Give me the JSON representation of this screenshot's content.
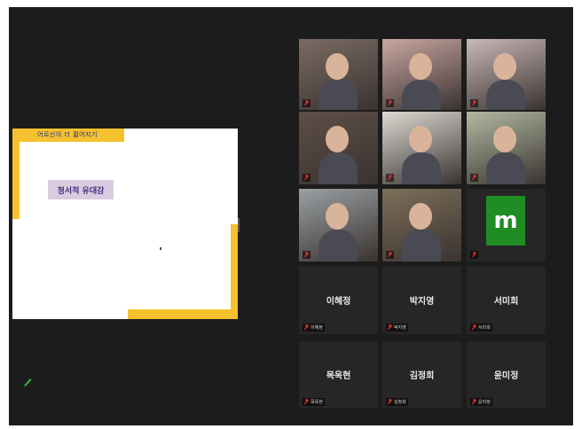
{
  "share": {
    "slide_banner": "어르신이 더 젊어지기",
    "slide_heading": "청서적 유대감"
  },
  "participants": [
    {
      "label": "",
      "type": "video",
      "bg": "#7a6b63",
      "active": false
    },
    {
      "label": "",
      "type": "video",
      "bg": "#c9a7a2",
      "active": false
    },
    {
      "label": "",
      "type": "video",
      "bg": "#c9b8b8",
      "active": false
    },
    {
      "label": "",
      "type": "video",
      "bg": "#5d4f47",
      "active": false
    },
    {
      "label": "",
      "type": "video",
      "bg": "#dcdad3",
      "active": true
    },
    {
      "label": "",
      "type": "video",
      "bg": "#b2b9a2",
      "active": false
    },
    {
      "label": "",
      "type": "video",
      "bg": "#9aa0a3",
      "active": false
    },
    {
      "label": "",
      "type": "video",
      "bg": "#7d6f5a",
      "active": false
    },
    {
      "label": "",
      "type": "avatar",
      "avatar_letter": "m",
      "avatar_color": "#1f8c24",
      "active": false
    },
    {
      "name": "이혜정",
      "label": "이혜정",
      "type": "name",
      "active": false
    },
    {
      "name": "박지영",
      "label": "박지영",
      "type": "name",
      "active": false
    },
    {
      "name": "서미희",
      "label": "서미희",
      "type": "name",
      "active": false
    },
    {
      "name": "목옥현",
      "label": "목옥현",
      "type": "name",
      "active": false
    },
    {
      "name": "김정희",
      "label": "김정희",
      "type": "name",
      "active": false
    },
    {
      "name": "윤미정",
      "label": "윤미정",
      "type": "name",
      "active": false
    }
  ],
  "colors": {
    "mic_muted": "#e03030",
    "active_border": "#9fbe3a",
    "accent": "#f5c12e"
  }
}
